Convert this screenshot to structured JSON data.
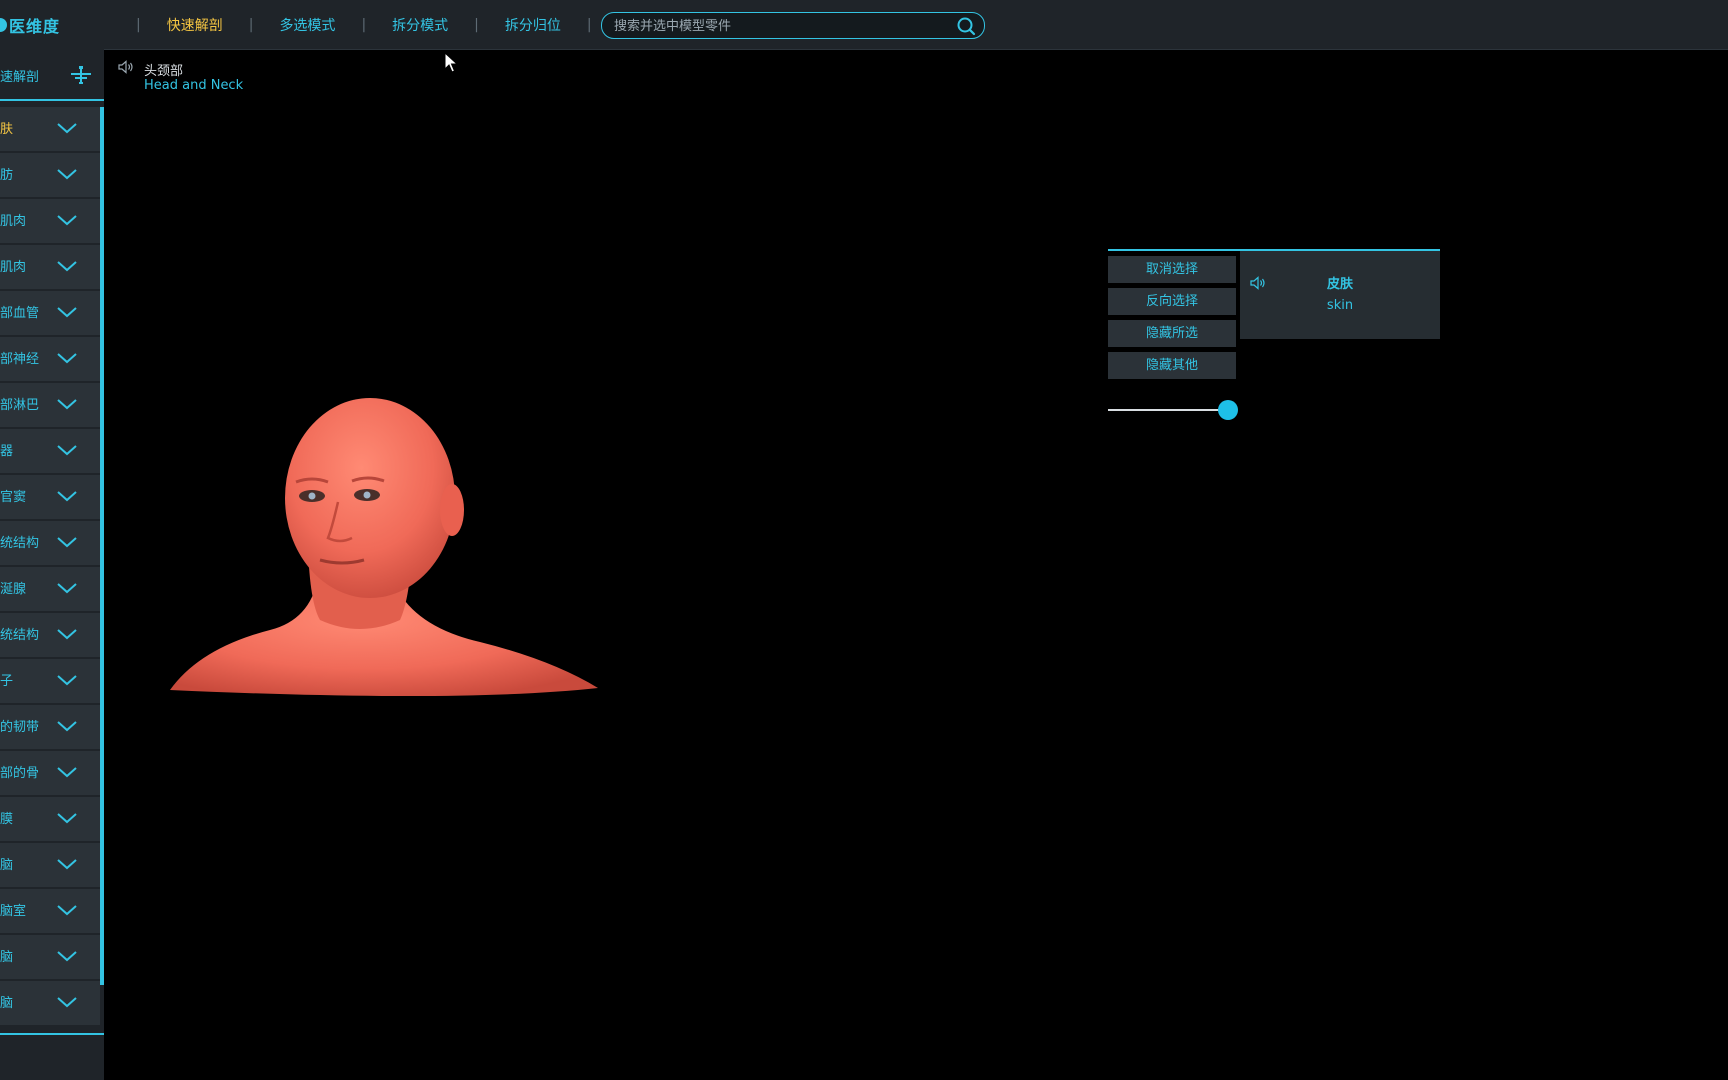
{
  "header": {
    "logo": "医维度",
    "nav": [
      {
        "label": "快速解剖",
        "active": true
      },
      {
        "label": "多选模式",
        "active": false
      },
      {
        "label": "拆分模式",
        "active": false
      },
      {
        "label": "拆分归位",
        "active": false
      }
    ],
    "search_placeholder": "搜索并选中模型零件",
    "search_icon": "search-icon"
  },
  "sidebar": {
    "title": "速解剖",
    "tree_icon": "tree-icon",
    "items": [
      {
        "label": "肤",
        "active": true
      },
      {
        "label": "肪",
        "active": false
      },
      {
        "label": "肌肉",
        "active": false
      },
      {
        "label": "肌肉",
        "active": false
      },
      {
        "label": "部血管",
        "active": false
      },
      {
        "label": "部神经",
        "active": false
      },
      {
        "label": "部淋巴",
        "active": false
      },
      {
        "label": "器",
        "active": false
      },
      {
        "label": "官窦",
        "active": false
      },
      {
        "label": "统结构",
        "active": false
      },
      {
        "label": "涎腺",
        "active": false
      },
      {
        "label": "统结构",
        "active": false
      },
      {
        "label": "子",
        "active": false
      },
      {
        "label": "的韧带",
        "active": false
      },
      {
        "label": "部的骨",
        "active": false
      },
      {
        "label": "膜",
        "active": false
      },
      {
        "label": "脑",
        "active": false
      },
      {
        "label": "脑室",
        "active": false
      },
      {
        "label": "脑",
        "active": false
      },
      {
        "label": "脑",
        "active": false
      }
    ]
  },
  "breadcrumb": {
    "zh": "头颈部",
    "en": "Head and Neck"
  },
  "selection": {
    "actions": [
      "取消选择",
      "反向选择",
      "隐藏所选",
      "隐藏其他"
    ],
    "name_zh": "皮肤",
    "name_en": "skin",
    "opacity": 1.0
  },
  "colors": {
    "accent": "#33c4e3",
    "active": "#f4c542",
    "panel": "#1f2429",
    "item": "#2b3238",
    "model_skin": "#f06a58"
  }
}
